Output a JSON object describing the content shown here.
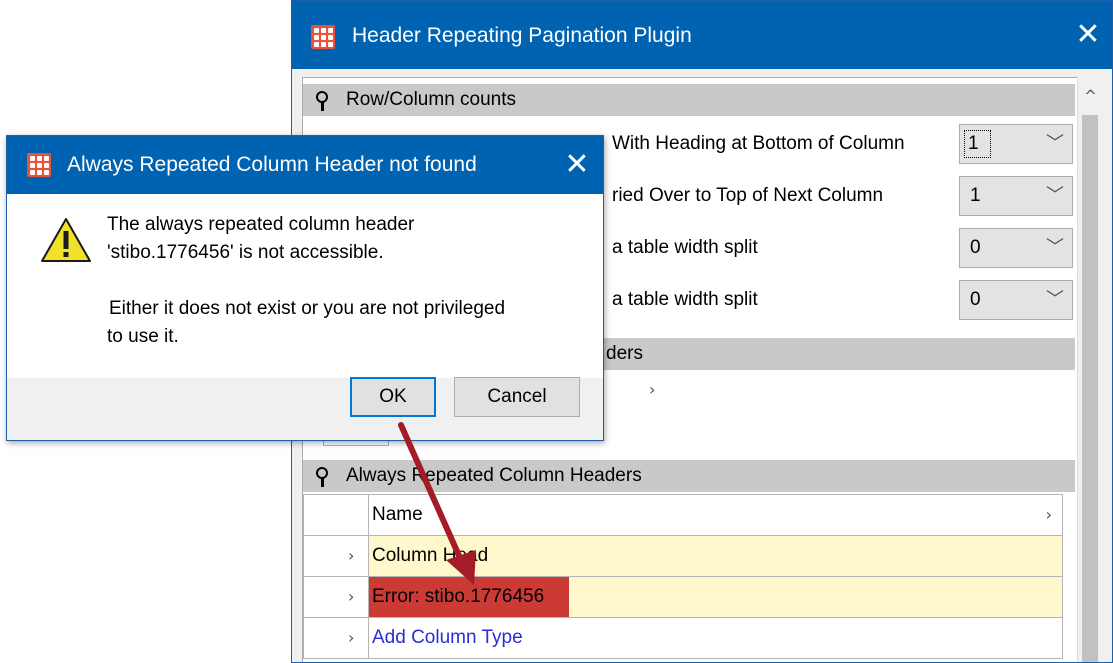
{
  "main_window": {
    "title": "Header Repeating Pagination Plugin",
    "close_glyph": "✕",
    "section_row_column_counts": "Row/Column counts",
    "rows": [
      {
        "label": "With Heading at Bottom of Column",
        "value": "1"
      },
      {
        "label": "ried Over to Top of Next Column",
        "value": "1"
      },
      {
        "label": "a table width split",
        "value": "0"
      },
      {
        "label": "a table width split",
        "value": "0"
      }
    ],
    "combo_chevron": "﹀",
    "section_headers_partial": "ders",
    "section_always_repeated": "Always Repeated Column Headers",
    "grid": {
      "column_header": "Name",
      "rows": [
        {
          "text": "Column Head",
          "state": "normal"
        },
        {
          "text": "Error: stibo.1776456",
          "state": "error"
        },
        {
          "text": "Add Column Type",
          "state": "link"
        }
      ],
      "row_bg": "#fff8cc",
      "error_bg": "#cb3a35"
    },
    "scroll_up_glyph": "^"
  },
  "dialog": {
    "title": "Always Repeated Column Header not found",
    "close_glyph": "✕",
    "message_line1": "The always repeated column header",
    "message_line2": "'stibo.1776456' is not accessible.",
    "message_line3": "Either it does not exist or you are not privileged",
    "message_line4": "to use it.",
    "ok_label": "OK",
    "cancel_label": "Cancel",
    "icon": "warning-icon"
  },
  "colors": {
    "title_bar": "#0063b1",
    "app_logo": "#e9533b",
    "arrow": "#a31c26",
    "warning_fill": "#f2e12b"
  }
}
